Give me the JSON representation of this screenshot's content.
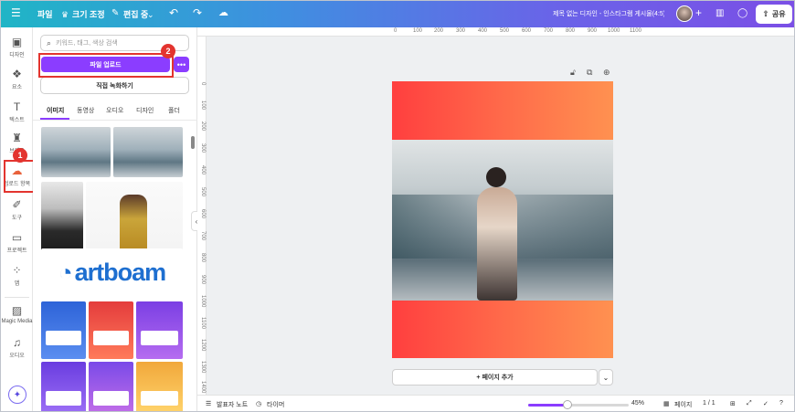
{
  "topbar": {
    "file": "파일",
    "resize": "크기 조정",
    "edit_mode": "편집 중",
    "doc_title": "제목 없는 디자인 - 인스타그램 게시물(4:5)",
    "share": "공유",
    "icons": [
      "menu-icon",
      "resize-icon",
      "pencil-icon",
      "undo-icon",
      "redo-icon",
      "cloud-check-icon",
      "plus-icon",
      "chart-icon",
      "comment-icon",
      "share-icon"
    ]
  },
  "rail": {
    "items": [
      {
        "icon": "design-icon",
        "label": "디자인"
      },
      {
        "icon": "elements-icon",
        "label": "요소"
      },
      {
        "icon": "text-icon",
        "label": "텍스트"
      },
      {
        "icon": "brand-icon",
        "label": "브랜드"
      },
      {
        "icon": "upload-icon",
        "label": "업로드 항목"
      },
      {
        "icon": "tools-icon",
        "label": "도구"
      },
      {
        "icon": "folder-icon",
        "label": "프로젝트"
      },
      {
        "icon": "apps-icon",
        "label": "앱"
      },
      {
        "icon": "magic-media-icon",
        "label": "Magic Media"
      },
      {
        "icon": "audio-icon",
        "label": "오디오"
      }
    ]
  },
  "panel": {
    "search_placeholder": "키워드, 태그, 색상 검색",
    "upload_button": "파일 업로드",
    "more": "•••",
    "record_button": "직접 녹화하기",
    "tabs": [
      "이미지",
      "동영상",
      "오디오",
      "디자인",
      "폴더"
    ],
    "logo_text": "artboam"
  },
  "annotations": {
    "badge1": "1",
    "badge2": "2"
  },
  "ruler": {
    "h": [
      "0",
      "100",
      "200",
      "300",
      "400",
      "500",
      "600",
      "700",
      "800",
      "900",
      "1000",
      "1100"
    ],
    "v": [
      "0",
      "100",
      "200",
      "300",
      "400",
      "500",
      "600",
      "700",
      "800",
      "900",
      "1000",
      "1100",
      "1200",
      "1300",
      "1400"
    ]
  },
  "canvas": {
    "add_page": "+ 페이지 추가",
    "chevron": "⌄"
  },
  "bottombar": {
    "notes": "발표자 노트",
    "timer": "타이머",
    "zoom": "45%",
    "pages": "페이지",
    "page_count": "1 / 1",
    "zoom_percent": 45
  },
  "colors": {
    "accent": "#8b3dff",
    "highlight": "#e3342f",
    "page_left": "#ff3f3f",
    "page_right": "#ff9150"
  }
}
